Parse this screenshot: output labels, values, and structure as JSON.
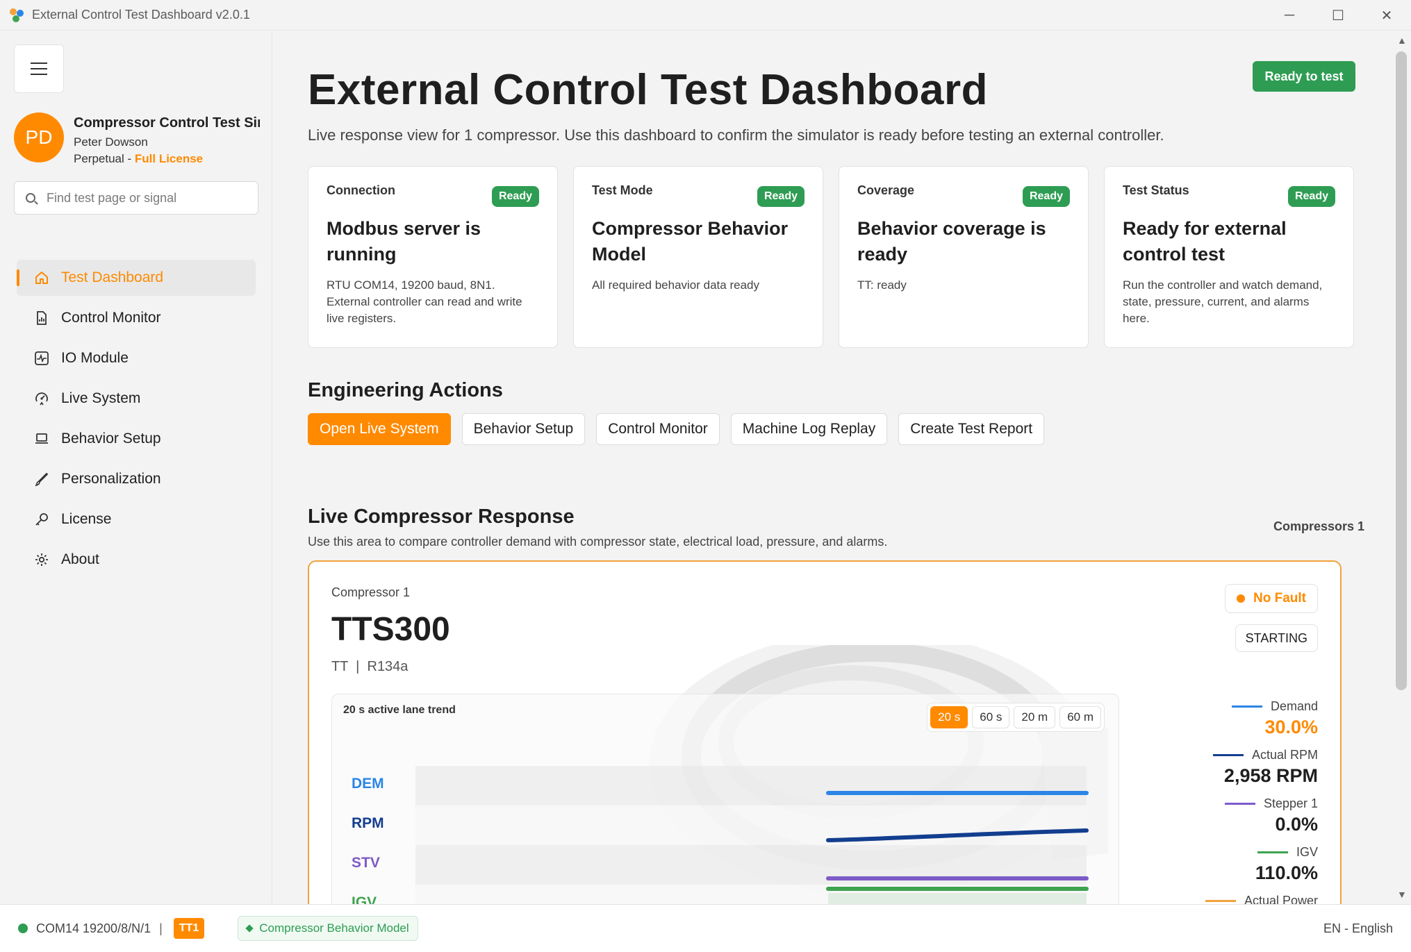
{
  "window": {
    "title": "External Control Test Dashboard v2.0.1",
    "minimize": "─",
    "maximize": "☐",
    "close": "✕"
  },
  "sidebar": {
    "profile": {
      "initials": "PD",
      "name": "Compressor Control Test Simulator",
      "user": "Peter Dowson",
      "license_type": "Perpetual - ",
      "license_level": "Full License"
    },
    "search": {
      "placeholder": "Find test page or signal"
    },
    "items": [
      {
        "label": "Test Dashboard",
        "icon": "home-icon",
        "active": true
      },
      {
        "label": "Control Monitor",
        "icon": "report-icon"
      },
      {
        "label": "IO Module",
        "icon": "pulse-icon"
      },
      {
        "label": "Live System",
        "icon": "gauge-icon"
      },
      {
        "label": "Behavior Setup",
        "icon": "laptop-icon"
      },
      {
        "label": "Personalization",
        "icon": "brush-icon"
      },
      {
        "label": "License",
        "icon": "key-icon"
      },
      {
        "label": "About",
        "icon": "gear-icon"
      }
    ]
  },
  "header": {
    "title": "External Control Test Dashboard",
    "subtitle": "Live response view for 1 compressor. Use this dashboard to confirm the simulator is ready before testing an external controller.",
    "status_button": "Ready to test"
  },
  "cards": [
    {
      "label": "Connection",
      "badge": "Ready",
      "title": "Modbus server is running",
      "desc": "RTU COM14, 19200 baud, 8N1. External controller can read and write live registers."
    },
    {
      "label": "Test Mode",
      "badge": "Ready",
      "title": "Compressor Behavior Model",
      "desc": "All required behavior data ready"
    },
    {
      "label": "Coverage",
      "badge": "Ready",
      "title": "Behavior coverage is ready",
      "desc": "TT: ready"
    },
    {
      "label": "Test Status",
      "badge": "Ready",
      "title": "Ready for external control test",
      "desc": "Run the controller and watch demand, state, pressure, current, and alarms here."
    }
  ],
  "actions": {
    "title": "Engineering Actions",
    "buttons": [
      "Open Live System",
      "Behavior Setup",
      "Control Monitor",
      "Machine Log Replay",
      "Create Test Report"
    ]
  },
  "response": {
    "title": "Live Compressor Response",
    "subtitle": "Use this area to compare controller demand with compressor state, electrical load, pressure, and alarms.",
    "count": "Compressors 1",
    "compressor": {
      "label": "Compressor 1",
      "model": "TTS300",
      "ref": "TT  |  R134a",
      "fault": "No Fault",
      "state": "STARTING",
      "trend": {
        "title": "20 s active lane trend",
        "ranges": [
          "20 s",
          "60 s",
          "20 m",
          "60 m"
        ],
        "active_range": "20 s",
        "lanes": [
          {
            "label": "DEM",
            "color": "#2a85e6"
          },
          {
            "label": "RPM",
            "color": "#133e8f"
          },
          {
            "label": "STV",
            "color": "#7d5bc7"
          },
          {
            "label": "IGV",
            "color": "#3fa24f"
          }
        ]
      },
      "metrics": [
        {
          "name": "Demand",
          "value": "30.0%",
          "color": "#2a85e6",
          "value_color": "#ff8a00"
        },
        {
          "name": "Actual RPM",
          "value": "2,958 RPM",
          "color": "#133e8f"
        },
        {
          "name": "Stepper 1",
          "value": "0.0%",
          "color": "#7d5bc7"
        },
        {
          "name": "IGV",
          "value": "110.0%",
          "color": "#3fa24f"
        },
        {
          "name": "Actual Power",
          "value": "",
          "color": "#f2a23c"
        }
      ]
    }
  },
  "statusbar": {
    "port": "COM14 19200/8/N/1",
    "sep": "|",
    "tag": "TT1",
    "model": "Compressor Behavior Model",
    "language": "EN - English"
  },
  "colors": {
    "accent": "#ff8a00",
    "ready": "#2e9d53"
  }
}
